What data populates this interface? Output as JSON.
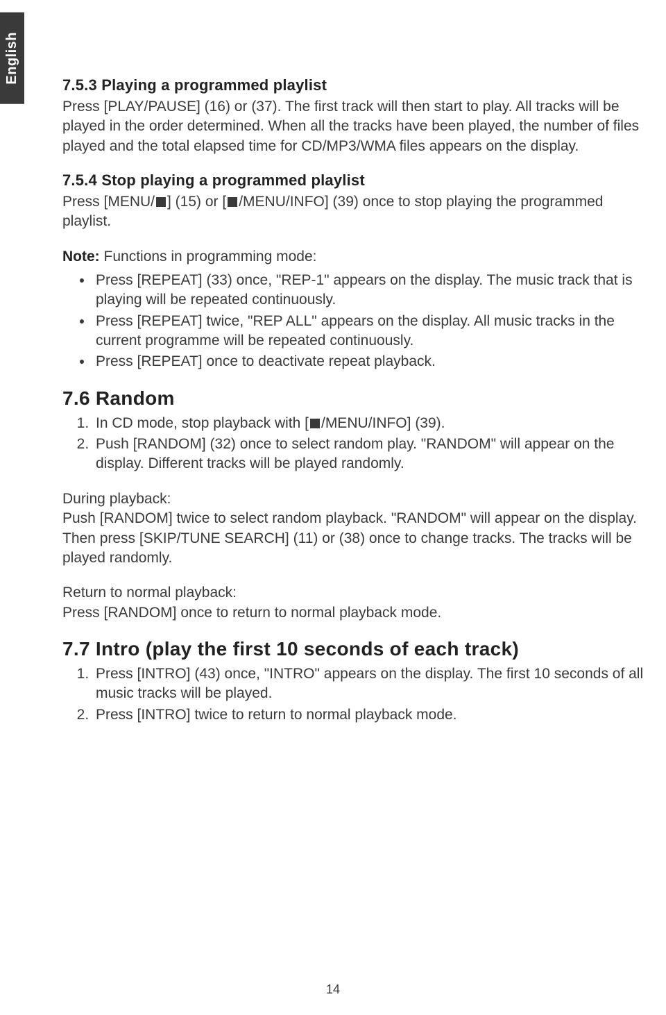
{
  "language_tab": "English",
  "page_number": "14",
  "section_753": {
    "heading": "7.5.3 Playing a programmed playlist",
    "body": "Press [PLAY/PAUSE] (16) or (37). The first track will then start to play. All tracks will be played in the order determined. When all the tracks have been played, the number of files played and the total elapsed time for CD/MP3/WMA files appears on the display."
  },
  "section_754": {
    "heading": "7.5.4 Stop playing a programmed playlist",
    "body_pre1": "Press [MENU/",
    "body_mid": "] (15) or [",
    "body_post": "/MENU/INFO] (39) once to stop playing the programmed playlist.",
    "note_label": "Note:",
    "note_text": " Functions in programming mode:",
    "bullets": [
      "Press [REPEAT] (33) once, \"REP-1\" appears on the display. The music track that is playing will be repeated continuously.",
      "Press [REPEAT] twice, \"REP ALL\" appears on the display. All music tracks in the current programme will be repeated continuously.",
      "Press [REPEAT] once to deactivate repeat playback."
    ]
  },
  "section_76": {
    "heading": "7.6  Random",
    "item1_pre": "In CD mode, stop playback with [",
    "item1_post": "/MENU/INFO] (39).",
    "item2": "Push [RANDOM] (32) once to select random play. \"RANDOM\" will appear on the display. Different tracks will be played randomly.",
    "during_label": "During playback:",
    "during_body": "Push [RANDOM] twice to select random playback. \"RANDOM\" will appear on the display. Then press [SKIP/TUNE SEARCH] (11) or (38) once to change tracks. The tracks will be played randomly.",
    "return_label": "Return to normal playback:",
    "return_body": "Press [RANDOM] once to return to normal playback mode."
  },
  "section_77": {
    "heading": "7.7  Intro (play the first 10 seconds of each track)",
    "items": [
      "Press [INTRO] (43) once, \"INTRO\" appears on the display. The first 10 seconds of all music tracks will be played.",
      "Press [INTRO] twice to return to normal playback mode."
    ]
  }
}
